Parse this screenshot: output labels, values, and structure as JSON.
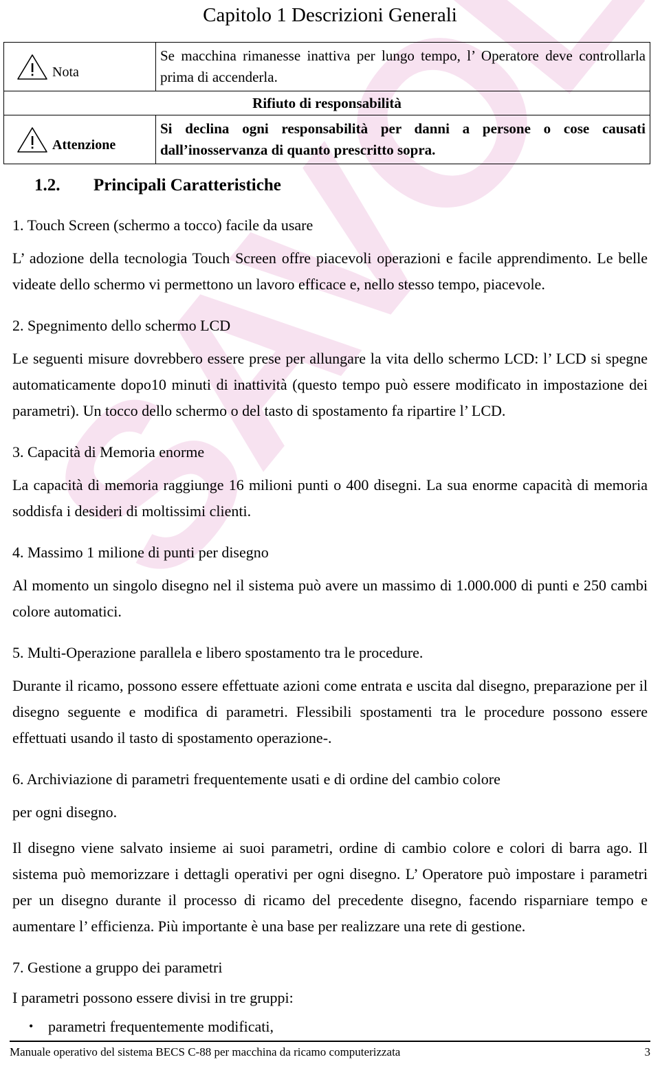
{
  "watermark": {
    "text": "SAVOLDI",
    "color": "#f7e2f0"
  },
  "header": {
    "chapter_title": "Capitolo 1 Descrizioni Generali"
  },
  "notice_table": {
    "rows": [
      {
        "icon": "warning-triangle-icon",
        "label": "Nota",
        "label_bold": false,
        "message": "Se macchina rimanesse inattiva per lungo tempo, l’ Operatore deve controllarla prima di accenderla.",
        "message_bold": false
      },
      {
        "span_title": "Rifiuto di responsabilità"
      },
      {
        "icon": "warning-triangle-icon",
        "label": "Attenzione",
        "label_bold": true,
        "message": "Si declina ogni responsabilità per danni a persone o cose causati dall’inosservanza di quanto prescritto sopra.",
        "message_bold": true
      }
    ]
  },
  "section": {
    "number": "1.2.",
    "title": "Principali Caratteristiche"
  },
  "features": [
    {
      "title": "1. Touch Screen (schermo a tocco) facile da usare",
      "paragraphs": [
        "L’ adozione della tecnologia Touch Screen offre piacevoli operazioni e facile apprendimento. Le belle videate dello schermo vi permettono un lavoro efficace e, nello stesso tempo, piacevole."
      ]
    },
    {
      "title": "2. Spegnimento dello schermo LCD",
      "paragraphs": [
        "Le seguenti misure dovrebbero essere prese per allungare la vita dello schermo LCD: l’ LCD si spegne automaticamente dopo10 minuti di inattività (questo tempo può essere modificato in impostazione dei parametri). Un tocco dello schermo o del tasto di spostamento fa ripartire l’ LCD."
      ]
    },
    {
      "title": "3. Capacità di Memoria enorme",
      "paragraphs": [
        "La capacità di memoria raggiunge 16 milioni punti o 400 disegni. La sua enorme capacità di memoria soddisfa i desideri di moltissimi clienti."
      ]
    },
    {
      "title": "4. Massimo 1 milione di punti per disegno",
      "paragraphs": [
        "Al momento un singolo disegno nel il sistema può avere un massimo di 1.000.000 di punti e 250 cambi colore automatici."
      ]
    },
    {
      "title": "5. Multi-Operazione parallela e libero spostamento tra le procedure.",
      "paragraphs": [
        "Durante il ricamo, possono essere effettuate azioni come entrata e uscita dal disegno, preparazione per il disegno seguente e modifica di parametri. Flessibili spostamenti tra le procedure possono essere effettuati usando il tasto di spostamento operazione-."
      ]
    },
    {
      "title": "6. Archiviazione di parametri frequentemente usati e di ordine del cambio colore",
      "paragraphs": [
        "per ogni disegno.",
        "Il disegno viene salvato insieme ai suoi parametri, ordine di cambio colore e colori di barra ago. Il sistema può memorizzare i dettagli operativi per ogni disegno. L’ Operatore può impostare i parametri per un disegno durante il processo di ricamo del precedente disegno, facendo risparniare tempo e aumentare l’ efficienza. Più importante è una base per realizzare una rete di gestione."
      ]
    },
    {
      "title": "7. Gestione a gruppo dei parametri",
      "paragraphs": [
        "I parametri possono essere divisi in tre gruppi:"
      ],
      "bullets": [
        "parametri frequentemente modificati,"
      ]
    }
  ],
  "footer": {
    "text": "Manuale operativo del sistema BECS C-88 per macchina da ricamo computerizzata",
    "page_number": "3"
  }
}
